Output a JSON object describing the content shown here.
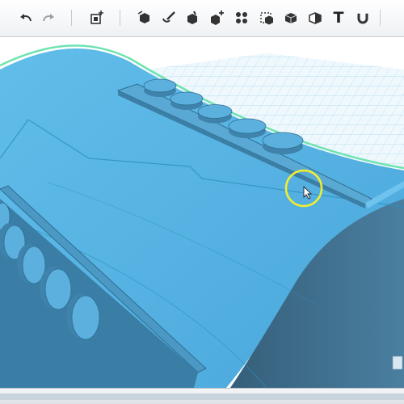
{
  "toolbar": {
    "buttons": [
      {
        "name": "undo-button",
        "icon": "undo-icon"
      },
      {
        "name": "redo-button",
        "icon": "redo-icon"
      },
      {
        "name": "add-shape-button",
        "icon": "add-shape-icon"
      },
      {
        "name": "transform-button",
        "icon": "transform-icon"
      },
      {
        "name": "tweak-button",
        "icon": "tweak-icon"
      },
      {
        "name": "adjust-button",
        "icon": "adjust-icon"
      },
      {
        "name": "combine-button",
        "icon": "combine-icon"
      },
      {
        "name": "pattern-button",
        "icon": "pattern-icon"
      },
      {
        "name": "modify-button",
        "icon": "modify-icon"
      },
      {
        "name": "solid-button",
        "icon": "solid-icon"
      },
      {
        "name": "material-button",
        "icon": "material-icon"
      },
      {
        "name": "text-button",
        "icon": "text-icon",
        "label": "T"
      },
      {
        "name": "snap-button",
        "icon": "magnet-icon"
      }
    ]
  },
  "viewport": {
    "model_color": "#5bb5e6",
    "model_shadow": "#3d6f8f",
    "grid_color": "#b9dcef",
    "highlight_color": "#6fe3b0",
    "cursor_ring_color": "#f2ee2e"
  }
}
